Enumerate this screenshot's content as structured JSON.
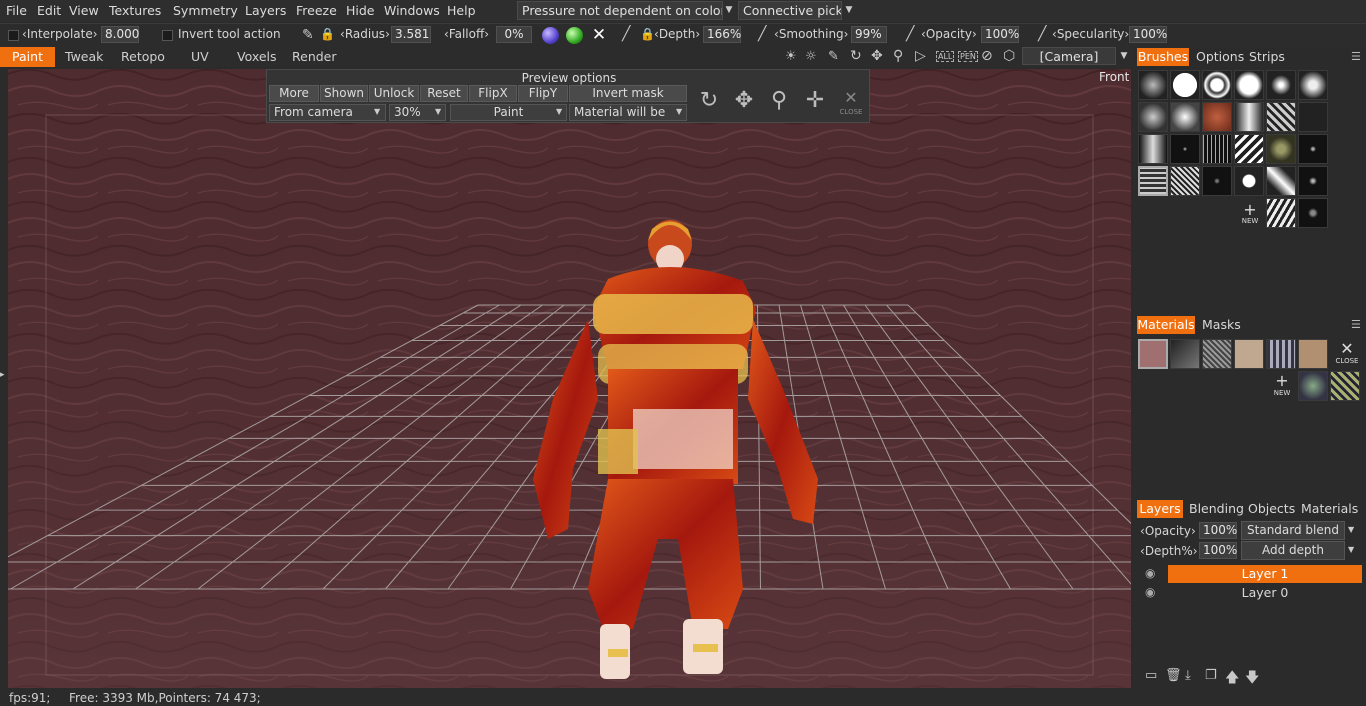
{
  "menu": {
    "items": [
      "File",
      "Edit",
      "View",
      "Textures",
      "Symmetry",
      "Layers",
      "Freeze",
      "Hide",
      "Windows",
      "Help"
    ]
  },
  "header": {
    "pressure_dropdown": "Pressure not dependent on color",
    "connective_dropdown": "Connective picki"
  },
  "toolbar": {
    "interpolate_label": "Interpolate",
    "interpolate_value": "8.000",
    "invert_label": "Invert tool action",
    "radius_label": "Radius",
    "radius_value": "3.581",
    "falloff_label": "Falloff",
    "falloff_value": "0%",
    "depth_label": "Depth",
    "depth_value": "166%",
    "smoothing_label": "Smoothing",
    "smoothing_value": "99%",
    "opacity_label": "Opacity",
    "opacity_value": "100%",
    "specularity_label": "Specularity",
    "specularity_value": "100%"
  },
  "rooms": {
    "tabs": [
      "Paint",
      "Tweak",
      "Retopo",
      "UV",
      "Voxels",
      "Render"
    ],
    "active": "Paint"
  },
  "view": {
    "camera": "[Camera]",
    "projection_label": "Front",
    "icon_all": "ALL",
    "icon_pen": "PEN"
  },
  "preview": {
    "title": "Preview options",
    "buttons": [
      "More",
      "Shown",
      "Unlock",
      "Reset",
      "FlipX",
      "FlipY",
      "Invert mask"
    ],
    "from_camera": "From camera",
    "scale": "30%",
    "mode": "Paint",
    "material": "Material will be",
    "close_label": "CLOSE"
  },
  "brushes_panel": {
    "tabs": [
      "Brushes",
      "Options",
      "Strips"
    ],
    "new_label": "NEW"
  },
  "materials_panel": {
    "tabs": [
      "Materials",
      "Masks"
    ],
    "close_label": "CLOSE",
    "new_label": "NEW"
  },
  "layers_panel": {
    "tabs": [
      "Layers",
      "Blending",
      "Objects",
      "Materials"
    ],
    "opacity_label": "Opacity",
    "opacity_value": "100%",
    "blend_mode": "Standard blend",
    "depth_label": "Depth%",
    "depth_value": "100%",
    "depth_mode": "Add depth",
    "layers": [
      {
        "name": "Layer 1",
        "active": true
      },
      {
        "name": "Layer 0",
        "active": false
      }
    ]
  },
  "status": {
    "fps": "fps:91;",
    "memory": "Free: 3393 Mb,Pointers: 74 473;"
  },
  "colors": {
    "accent": "#f07010",
    "viewport_bg": "#4c2a2d",
    "panel_bg": "#2b2b2b"
  }
}
